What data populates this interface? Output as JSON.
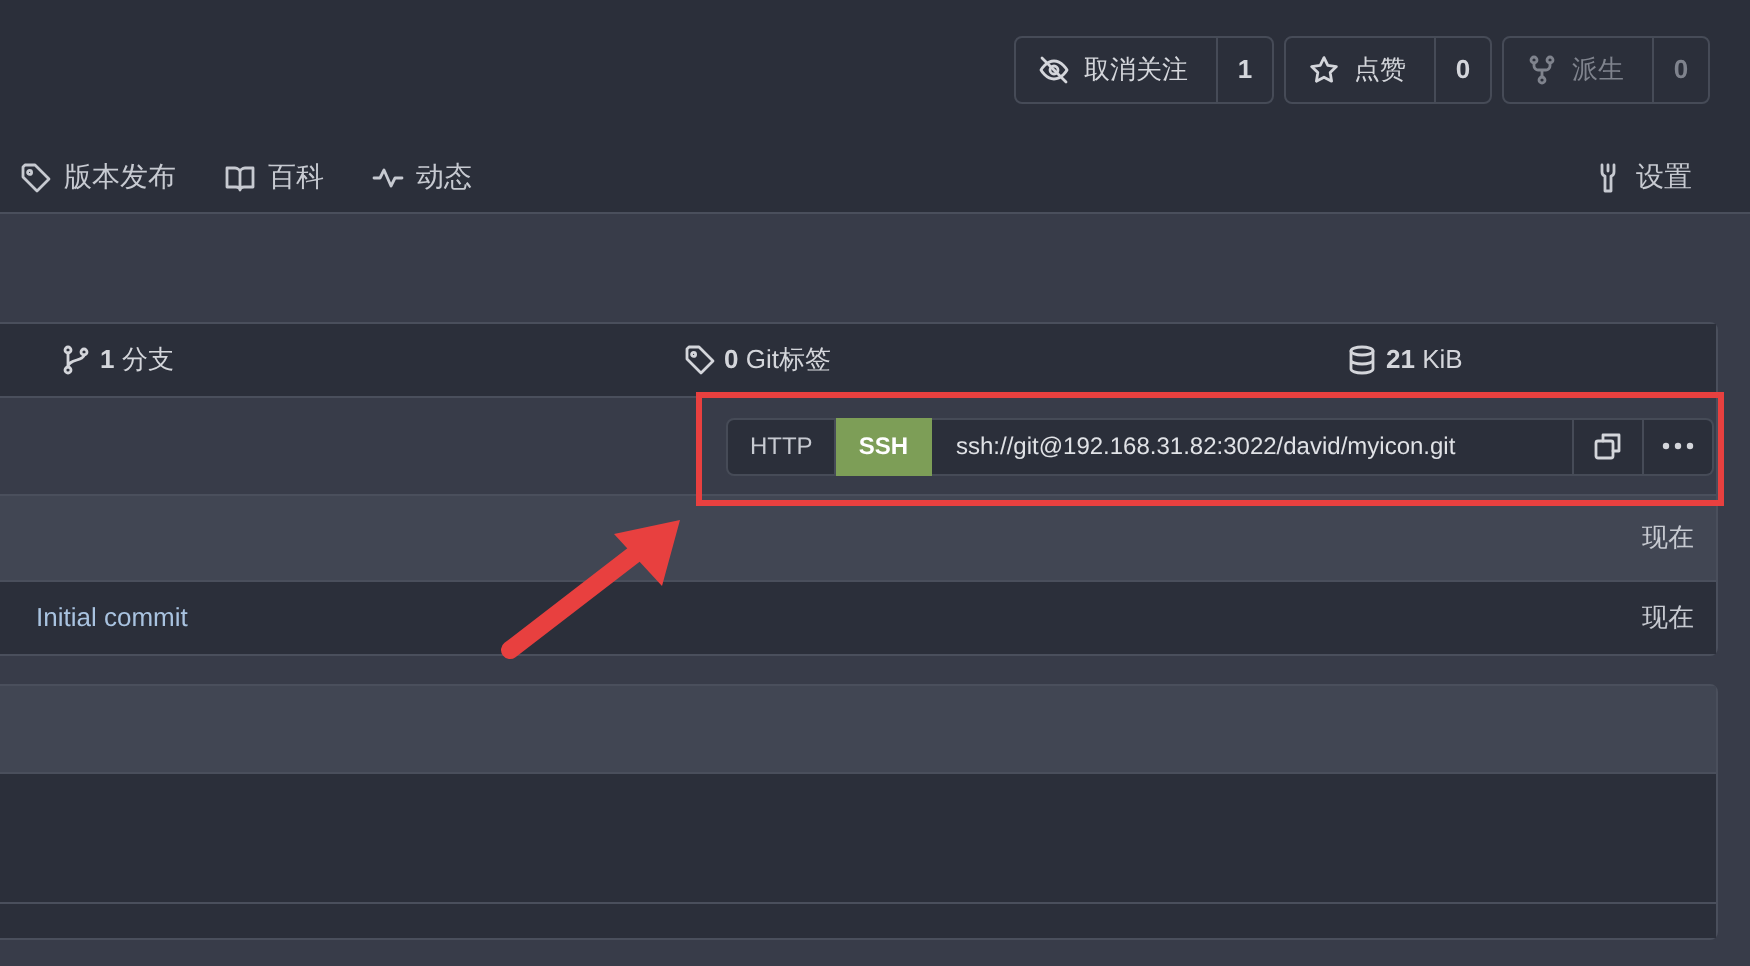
{
  "header_buttons": [
    {
      "label": "取消关注",
      "count": "1",
      "disabled": false
    },
    {
      "label": "点赞",
      "count": "0",
      "disabled": false
    },
    {
      "label": "派生",
      "count": "0",
      "disabled": true
    }
  ],
  "nav_tabs": [
    {
      "label": "版本发布"
    },
    {
      "label": "百科"
    },
    {
      "label": "动态"
    }
  ],
  "settings_tab": {
    "label": "设置"
  },
  "stats": [
    {
      "value": "1",
      "label": "分支"
    },
    {
      "value": "0",
      "label": "Git标签"
    },
    {
      "value": "21",
      "label": "KiB"
    }
  ],
  "clone": {
    "protocols": [
      {
        "label": "HTTP",
        "selected": false
      },
      {
        "label": "SSH",
        "selected": true
      }
    ],
    "url": "ssh://git@192.168.31.82:3022/david/myicon.git"
  },
  "latest_commit": {
    "time": "现在"
  },
  "rows": [
    {
      "message": "Initial commit",
      "time": "现在"
    }
  ]
}
